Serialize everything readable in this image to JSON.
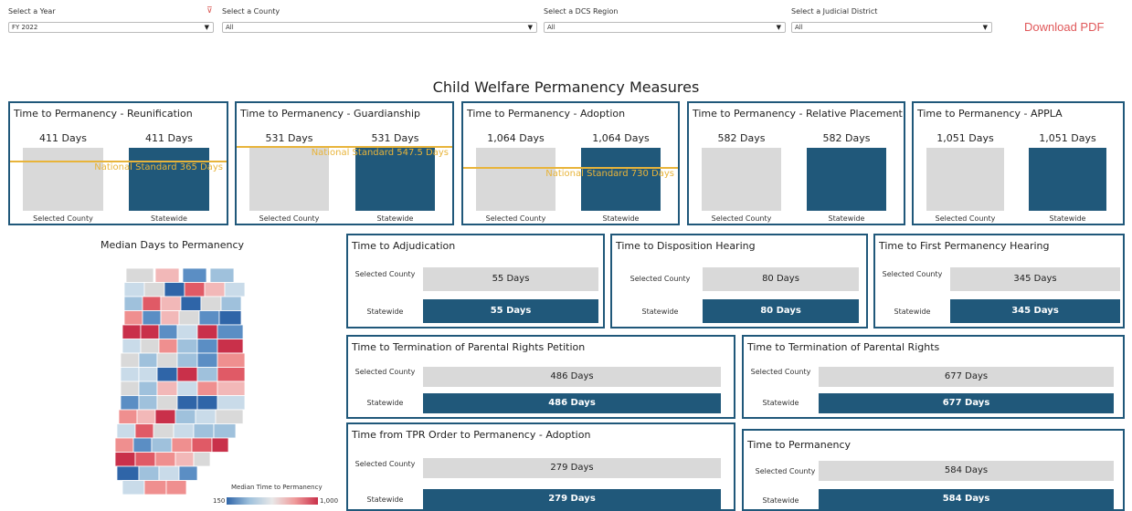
{
  "filters": {
    "year": {
      "label": "Select a Year",
      "value": "FY 2022"
    },
    "county": {
      "label": "Select a County",
      "value": "All"
    },
    "region": {
      "label": "Select a DCS Region",
      "value": "All"
    },
    "district": {
      "label": "Select a Judicial District",
      "value": "All"
    }
  },
  "download_label": "Download PDF",
  "title": "Child Welfare Permanency Measures",
  "categories": {
    "county": "Selected County",
    "statewide": "Statewide"
  },
  "permanency_cards": [
    {
      "title": "Time to Permanency - Reunification",
      "county_value": "411 Days",
      "statewide_value": "411 Days",
      "national": "National Standard 365 Days",
      "ratio_line": 0.8
    },
    {
      "title": "Time to Permanency - Guardianship",
      "county_value": "531 Days",
      "statewide_value": "531 Days",
      "national": "National Standard 547.5 Days",
      "ratio_line": 1.03
    },
    {
      "title": "Time to Permanency - Adoption",
      "county_value": "1,064 Days",
      "statewide_value": "1,064 Days",
      "national": "National Standard 730 Days",
      "ratio_line": 0.69
    },
    {
      "title": "Time to Permanency - Relative Placement",
      "county_value": "582 Days",
      "statewide_value": "582 Days",
      "national": "",
      "ratio_line": null
    },
    {
      "title": "Time to Permanency - APPLA",
      "county_value": "1,051 Days",
      "statewide_value": "1,051 Days",
      "national": "",
      "ratio_line": null
    }
  ],
  "map": {
    "title": "Median Days to Permanency",
    "legend_title": "Median Time to Permanency",
    "legend_min": "150",
    "legend_max": "1,000"
  },
  "row_labels": {
    "county_two_line": "Selected County",
    "statewide": "Statewide"
  },
  "measure_cards": {
    "adjudication": {
      "title": "Time to Adjudication",
      "county": "55 Days",
      "statewide": "55 Days"
    },
    "disposition": {
      "title": "Time to Disposition Hearing",
      "county": "80 Days",
      "statewide": "80 Days"
    },
    "first_perm_hearing": {
      "title": "Time to First Permanency Hearing",
      "county": "345 Days",
      "statewide": "345 Days"
    },
    "tpr_petition": {
      "title": "Time to Termination of Parental Rights Petition",
      "county": "486 Days",
      "statewide": "486 Days"
    },
    "tpr": {
      "title": "Time to Termination of Parental Rights",
      "county": "677 Days",
      "statewide": "677 Days"
    },
    "tpr_order_adoption": {
      "title": "Time from TPR Order to Permanency - Adoption",
      "county": "279 Days",
      "statewide": "279 Days"
    },
    "permanency": {
      "title": "Time to Permanency",
      "county": "584 Days",
      "statewide": "584 Days"
    }
  }
}
